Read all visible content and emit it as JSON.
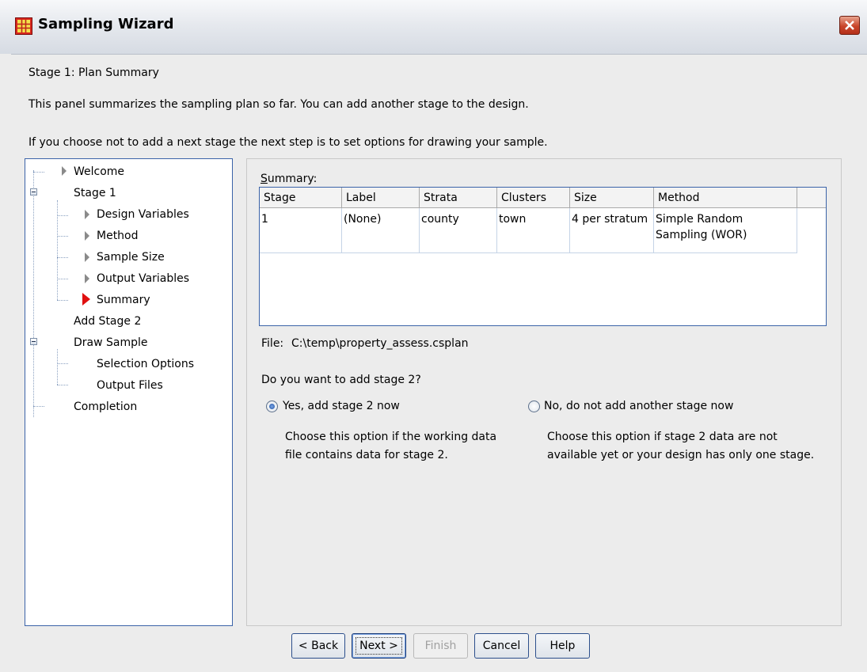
{
  "window": {
    "title": "Sampling Wizard"
  },
  "intro": {
    "stage_title": "Stage 1: Plan Summary",
    "line1": "This panel summarizes the sampling plan so far. You can add another stage to the design.",
    "line2": "If you choose not to add a next stage the next step is to set options for drawing your sample."
  },
  "nav": {
    "items": [
      {
        "label": "Welcome"
      },
      {
        "label": "Stage 1"
      },
      {
        "label": "Design Variables"
      },
      {
        "label": "Method"
      },
      {
        "label": "Sample Size"
      },
      {
        "label": "Output Variables"
      },
      {
        "label": "Summary"
      },
      {
        "label": "Add Stage 2"
      },
      {
        "label": "Draw Sample"
      },
      {
        "label": "Selection Options"
      },
      {
        "label": "Output Files"
      },
      {
        "label": "Completion"
      }
    ],
    "current": "Summary"
  },
  "summary": {
    "label": "Summary:",
    "columns": [
      "Stage",
      "Label",
      "Strata",
      "Clusters",
      "Size",
      "Method"
    ],
    "rows": [
      [
        "1",
        "(None)",
        "county",
        "town",
        "4 per stratum",
        "Simple Random Sampling (WOR)"
      ]
    ]
  },
  "file": {
    "label": "File:",
    "path": "C:\\temp\\property_assess.csplan"
  },
  "question": "Do you want to add stage 2?",
  "options": {
    "yes": {
      "label": "Yes, add stage 2 now",
      "desc_line1": "Choose this option if the working data",
      "desc_line2": "file contains data for stage 2.",
      "checked": true
    },
    "no": {
      "label": "No, do not add another stage now",
      "desc_line1": "Choose this option if stage 2 data are not",
      "desc_line2": "available yet or your design has only one stage.",
      "checked": false
    }
  },
  "buttons": {
    "back": "< Back",
    "next": "Next >",
    "finish": "Finish",
    "cancel": "Cancel",
    "help": "Help"
  },
  "colors": {
    "accent_border": "#3b63a8",
    "current_step_marker": "#e01010",
    "close_button": "#c9452a"
  }
}
